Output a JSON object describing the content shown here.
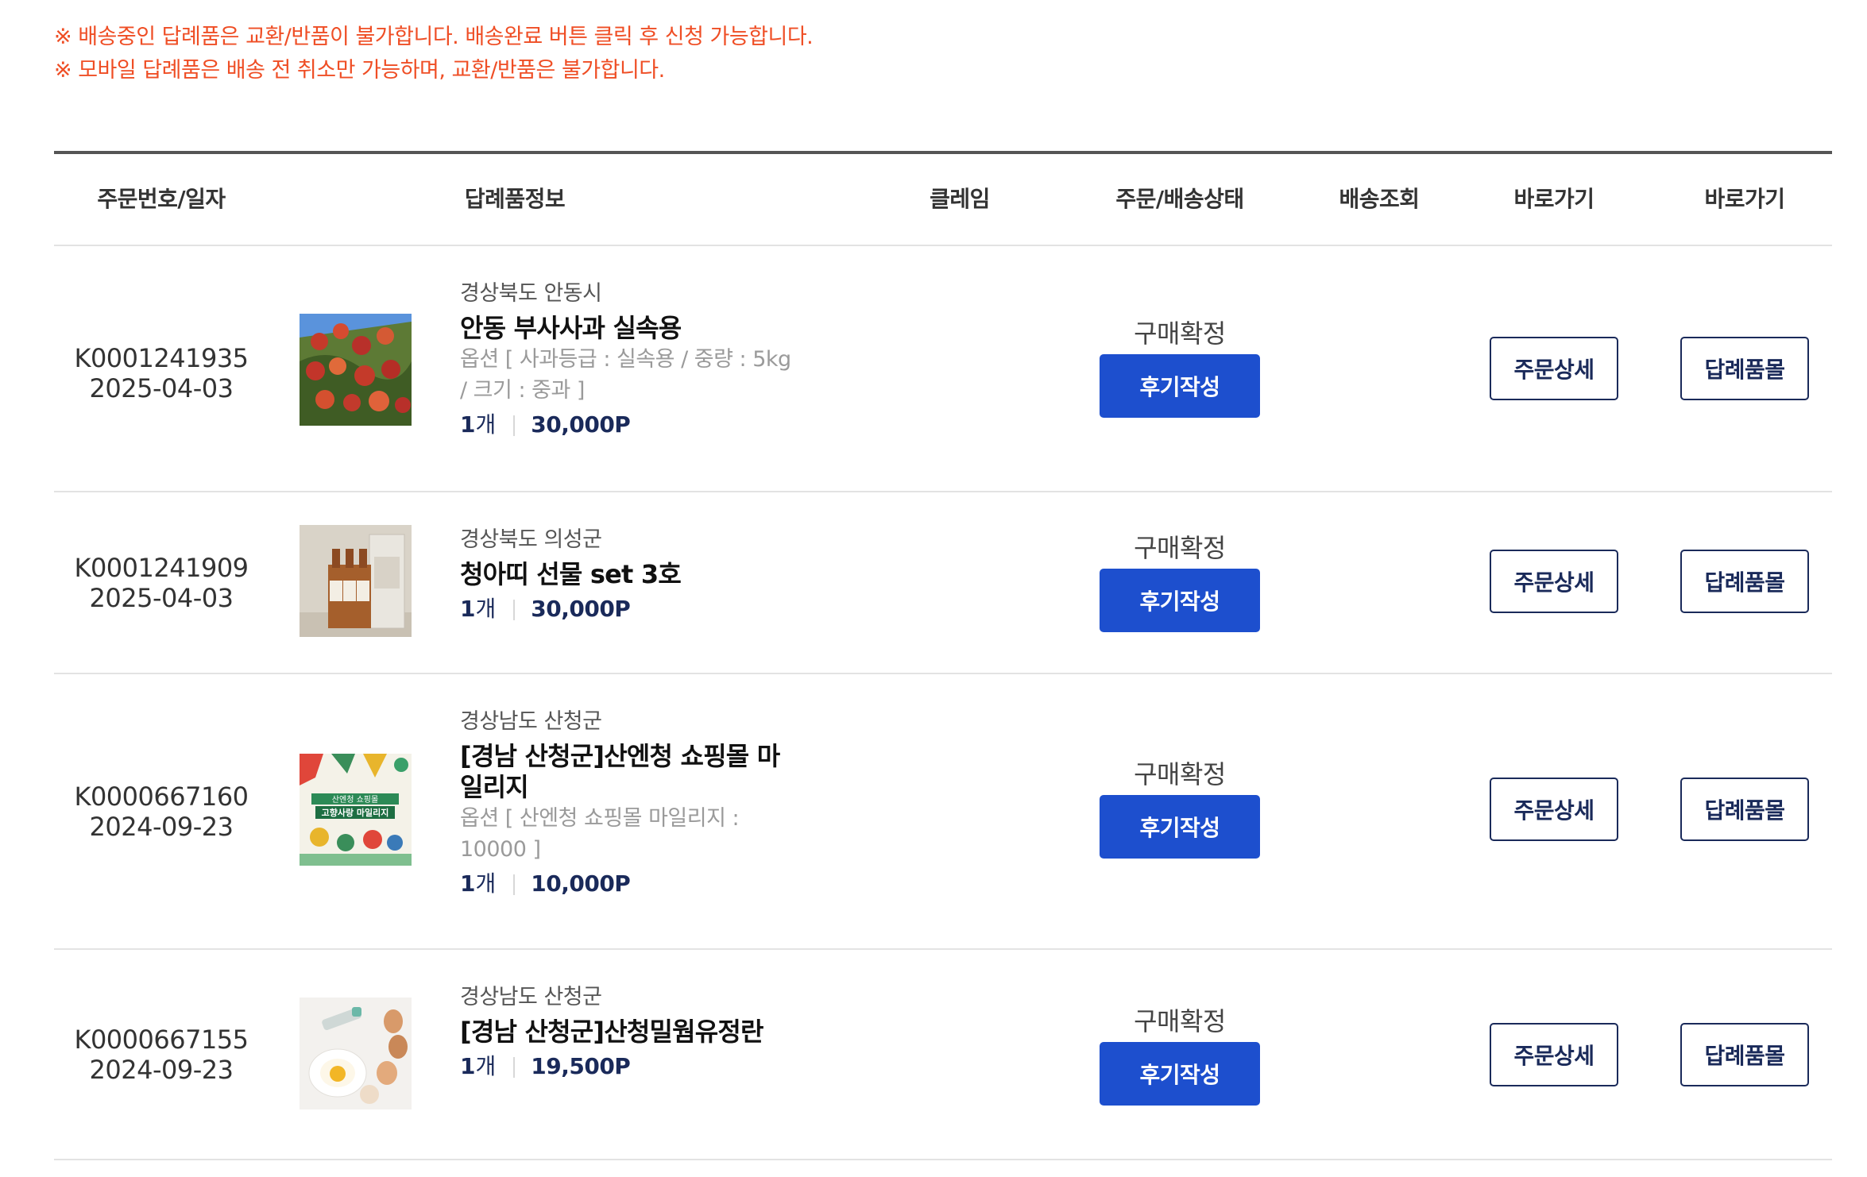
{
  "notices": [
    "※ 배송중인 답례품은 교환/반품이 불가합니다. 배송완료 버튼 클릭 후 신청 가능합니다.",
    "※ 모바일 답례품은 배송 전 취소만 가능하며, 교환/반품은 불가합니다."
  ],
  "headers": {
    "order": "주문번호/일자",
    "product": "답례품정보",
    "claim": "클레임",
    "status": "주문/배송상태",
    "tracking": "배송조회",
    "goto1": "바로가기",
    "goto2": "바로가기"
  },
  "orders": [
    {
      "order_no": "K0001241935",
      "date": "2025-04-03",
      "region": "경상북도 안동시",
      "name": "안동 부사사과 실속용",
      "option": "옵션 [ 사과등급 : 실속용 / 중량 : 5kg / 크기 : 중과 ]",
      "qty_num": "1",
      "qty_unit": "개",
      "price": "30,000P",
      "status": "구매확정",
      "review_label": "후기작성",
      "detail_label": "주문상세",
      "mall_label": "답례품몰",
      "image": "apple-tree-photo"
    },
    {
      "order_no": "K0001241909",
      "date": "2025-04-03",
      "region": "경상북도 의성군",
      "name": "청아띠 선물 set 3호",
      "option": "",
      "qty_num": "1",
      "qty_unit": "개",
      "price": "30,000P",
      "status": "구매확정",
      "review_label": "후기작성",
      "detail_label": "주문상세",
      "mall_label": "답례품몰",
      "image": "gift-bottles-photo"
    },
    {
      "order_no": "K0000667160",
      "date": "2024-09-23",
      "region": "경상남도 산청군",
      "name": "[경남 산청군]산엔청 쇼핑몰 마일리지",
      "option": "옵션 [ 산엔청 쇼핑몰 마일리지 : 10000 ]",
      "qty_num": "1",
      "qty_unit": "개",
      "price": "10,000P",
      "status": "구매확정",
      "review_label": "후기작성",
      "detail_label": "주문상세",
      "mall_label": "답례품몰",
      "image": "mileage-poster",
      "image_text": [
        "산엔청 쇼핑몰",
        "고향사랑 마일리지"
      ]
    },
    {
      "order_no": "K0000667155",
      "date": "2024-09-23",
      "region": "경상남도 산청군",
      "name": "[경남 산청군]산청밀웜유정란",
      "option": "",
      "qty_num": "1",
      "qty_unit": "개",
      "price": "19,500P",
      "status": "구매확정",
      "review_label": "후기작성",
      "detail_label": "주문상세",
      "mall_label": "답례품몰",
      "image": "eggs-photo"
    }
  ]
}
